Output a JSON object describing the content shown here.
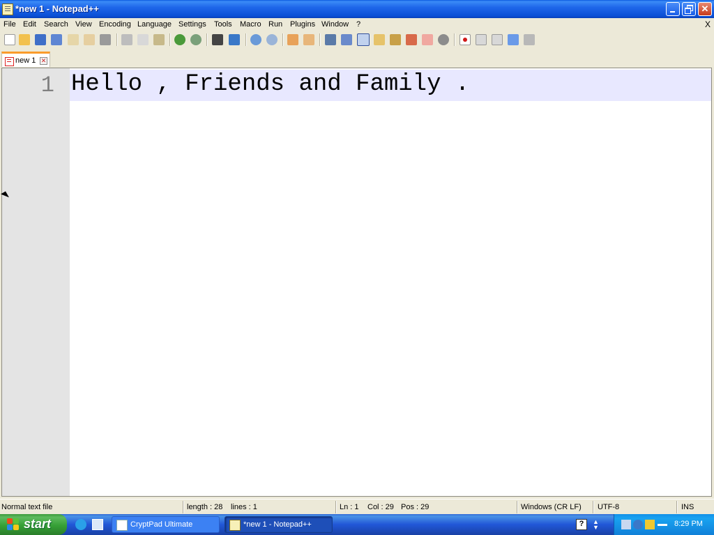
{
  "window": {
    "title": "*new 1 - Notepad++"
  },
  "menu": {
    "items": [
      "File",
      "Edit",
      "Search",
      "View",
      "Encoding",
      "Language",
      "Settings",
      "Tools",
      "Macro",
      "Run",
      "Plugins",
      "Window",
      "?"
    ],
    "close_doc": "X"
  },
  "toolbar": {
    "icons": [
      "new-file-icon",
      "open-file-icon",
      "save-icon",
      "save-all-icon",
      "close-icon",
      "close-all-icon",
      "print-icon",
      "cut-icon",
      "copy-icon",
      "paste-icon",
      "undo-icon",
      "redo-icon",
      "find-icon",
      "replace-icon",
      "zoom-in-icon",
      "zoom-out-icon",
      "sync-vertical-icon",
      "sync-horizontal-icon",
      "word-wrap-icon",
      "show-all-chars-icon",
      "indent-guide-icon",
      "document-map-icon",
      "function-list-icon",
      "user-language-icon",
      "folder-workspace-icon",
      "monitoring-icon",
      "record-macro-icon",
      "stop-record-icon",
      "play-macro-icon",
      "run-macro-multiple-icon",
      "save-macro-icon"
    ]
  },
  "tabs": [
    {
      "label": "new 1",
      "close": "✕"
    }
  ],
  "editor": {
    "line_number": "1",
    "text": "Hello , Friends and Family ."
  },
  "status": {
    "file_type": "Normal text file",
    "length": "length : 28",
    "lines": "lines : 1",
    "ln": "Ln : 1",
    "col": "Col : 29",
    "pos": "Pos : 29",
    "eol": "Windows (CR LF)",
    "encoding": "UTF-8",
    "mode": "INS"
  },
  "taskbar": {
    "start_label": "start",
    "tasks": [
      {
        "label": "CryptPad Ultimate"
      },
      {
        "label": "*new 1 - Notepad++"
      }
    ],
    "clock": "8:29 PM"
  },
  "colors": {
    "title_bar": "#0a4fd6",
    "current_line": "#e8e8ff",
    "tab_accent": "#fa9b2b",
    "start_green": "#36a036"
  }
}
